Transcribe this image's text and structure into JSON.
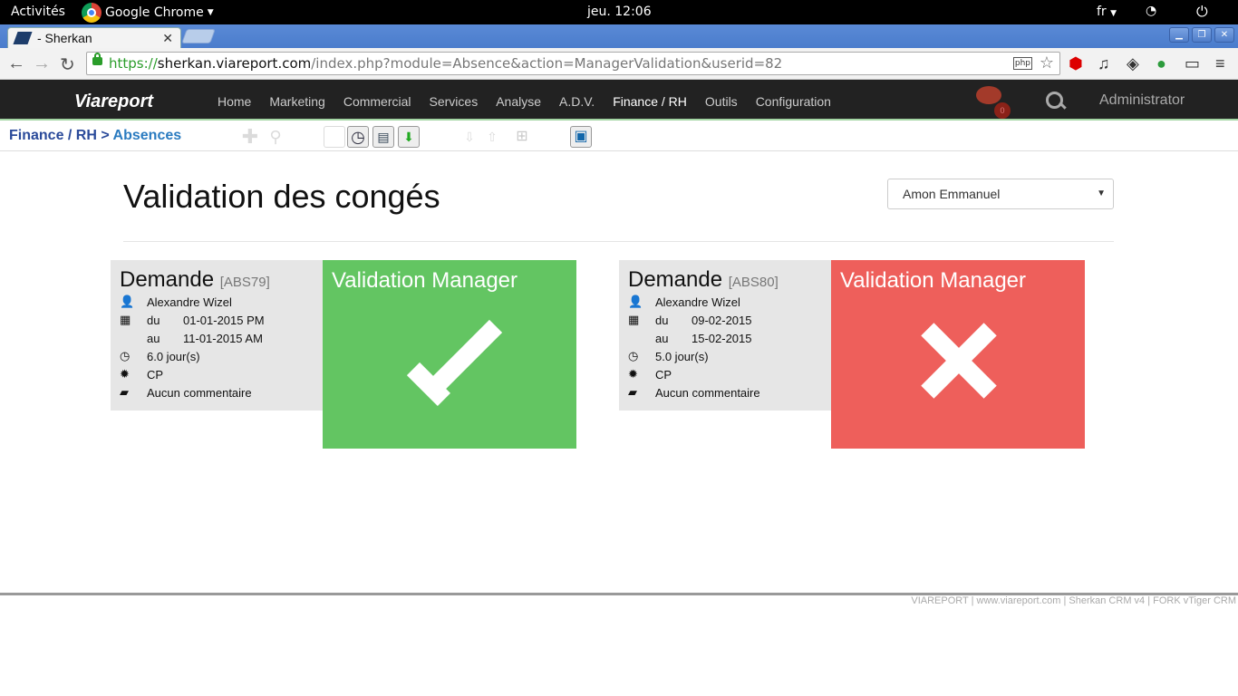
{
  "system": {
    "activities": "Activités",
    "app_name": "Google Chrome",
    "clock": "jeu. 12:06",
    "lang": "fr"
  },
  "browser": {
    "tab_title": "- Sherkan",
    "url_scheme": "https://",
    "url_host": "sherkan.viareport.com",
    "url_path": "/index.php?module=Absence&action=ManagerValidation&userid=82",
    "php_badge": "php"
  },
  "app": {
    "brand": "Viareport",
    "menu": [
      "Home",
      "Marketing",
      "Commercial",
      "Services",
      "Analyse",
      "A.D.V.",
      "Finance / RH",
      "Outils",
      "Configuration"
    ],
    "active_menu": "Finance / RH",
    "notification_count": "0",
    "user": "Administrator"
  },
  "breadcrumb": {
    "parent": "Finance / RH",
    "sep": " > ",
    "current": "Absences"
  },
  "page": {
    "title": "Validation des congés",
    "employee_select": "Amon Emmanuel"
  },
  "requests": [
    {
      "heading": "Demande",
      "ref": "[ABS79]",
      "employee": "Alexandre Wizel",
      "from_label": "du",
      "from": "01-01-2015 PM",
      "to_label": "au",
      "to": "11-01-2015 AM",
      "days": "6.0 jour(s)",
      "type": "CP",
      "comment": "Aucun commentaire",
      "validation_title": "Validation Manager",
      "validation_status": "approved",
      "status_color": "#63c562"
    },
    {
      "heading": "Demande",
      "ref": "[ABS80]",
      "employee": "Alexandre Wizel",
      "from_label": "du",
      "from": "09-02-2015",
      "to_label": "au",
      "to": "15-02-2015",
      "days": "5.0 jour(s)",
      "type": "CP",
      "comment": "Aucun commentaire",
      "validation_title": "Validation Manager",
      "validation_status": "rejected",
      "status_color": "#ee5f5b"
    }
  ],
  "footer": "VIAREPORT | www.viareport.com | Sherkan CRM v4 | FORK vTiger CRM"
}
